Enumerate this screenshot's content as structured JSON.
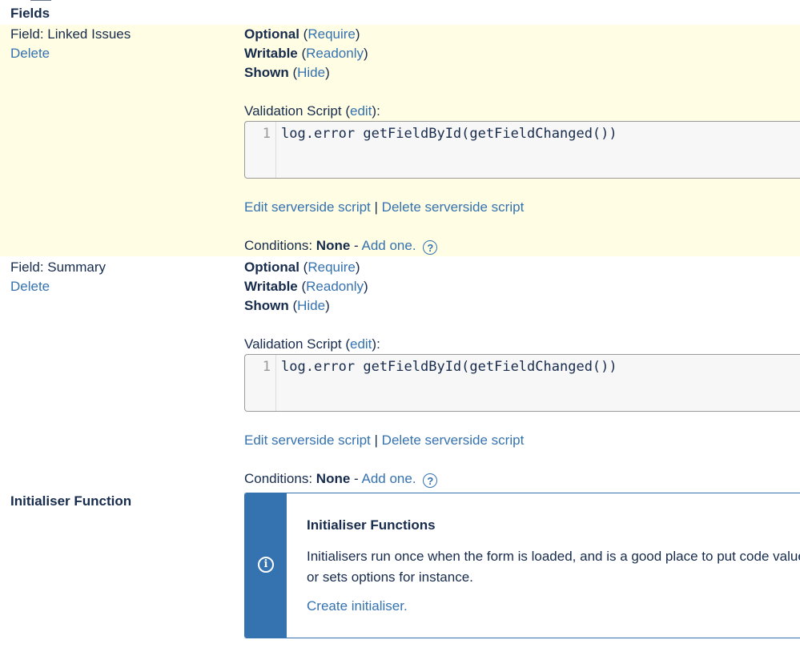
{
  "section": {
    "title": "Fields"
  },
  "fields": [
    {
      "name": "Field: Linked Issues",
      "delete_label": "Delete",
      "optional_label": "Optional",
      "require_link": "Require",
      "writable_label": "Writable",
      "readonly_link": "Readonly",
      "shown_label": "Shown",
      "hide_link": "Hide",
      "validation_label": "Validation Script",
      "edit_link": "edit",
      "line_number": "1",
      "code": "log.error getFieldById(getFieldChanged())",
      "edit_serverside": "Edit serverside script",
      "separator": "|",
      "delete_serverside": "Delete serverside script",
      "conditions_label": "Conditions:",
      "conditions_value": "None",
      "dash": "-",
      "add_one": "Add one."
    },
    {
      "name": "Field: Summary",
      "delete_label": "Delete",
      "optional_label": "Optional",
      "require_link": "Require",
      "writable_label": "Writable",
      "readonly_link": "Readonly",
      "shown_label": "Shown",
      "hide_link": "Hide",
      "validation_label": "Validation Script",
      "edit_link": "edit",
      "line_number": "1",
      "code": "log.error getFieldById(getFieldChanged())",
      "edit_serverside": "Edit serverside script",
      "separator": "|",
      "delete_serverside": "Delete serverside script",
      "conditions_label": "Conditions:",
      "conditions_value": "None",
      "dash": "-",
      "add_one": "Add one."
    }
  ],
  "initialiser": {
    "label": "Initialiser Function",
    "title": "Initialiser Functions",
    "body": "Initialisers run once when the form is loaded, and is a good place to put code values, or sets options for instance.",
    "link": "Create initialiser."
  },
  "colors": {
    "link": "#3572b0",
    "highlight": "#fffde3",
    "info_bar": "#3572b0"
  },
  "icons": {
    "help": "question-circle-icon",
    "info": "info-circle-icon"
  }
}
